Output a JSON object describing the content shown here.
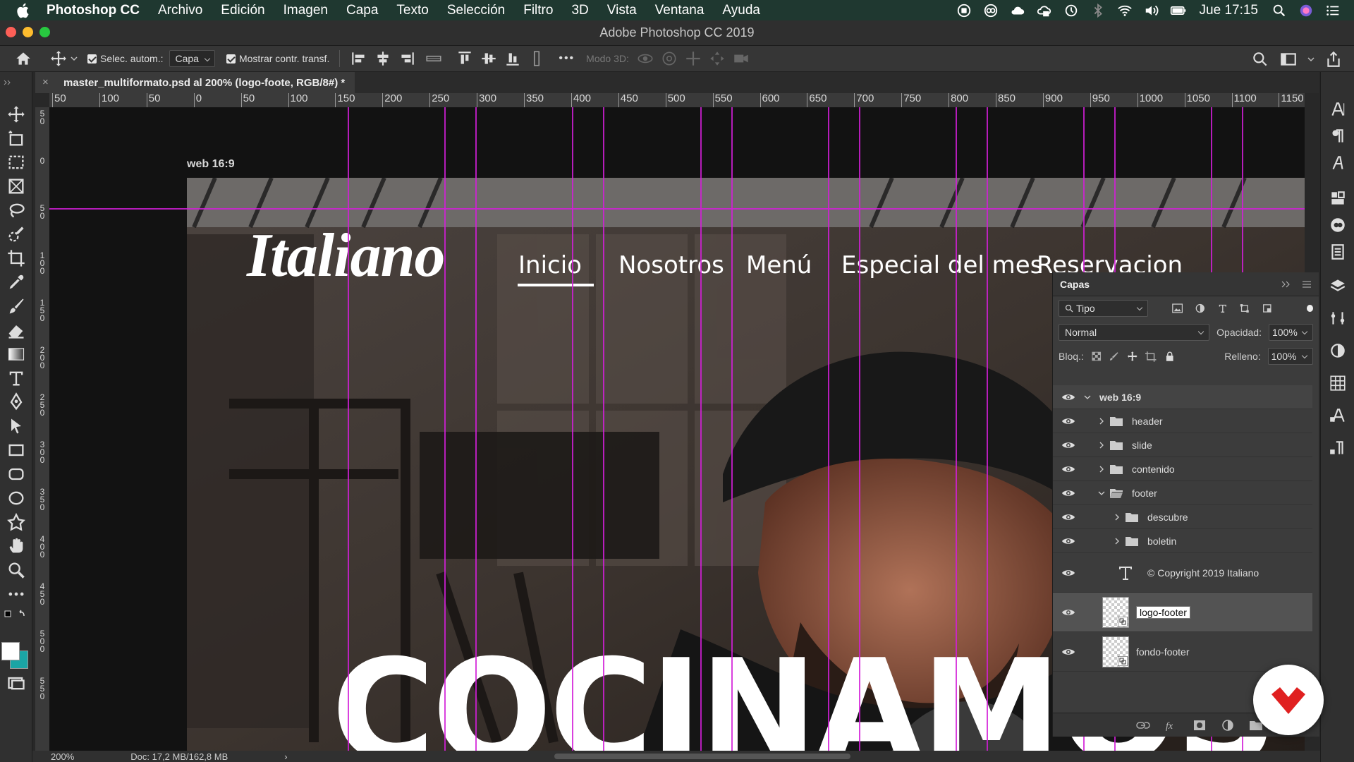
{
  "menubar": {
    "app_name": "Photoshop CC",
    "items": [
      "Archivo",
      "Edición",
      "Imagen",
      "Capa",
      "Texto",
      "Selección",
      "Filtro",
      "3D",
      "Vista",
      "Ventana",
      "Ayuda"
    ],
    "clock": "Jue 17:15"
  },
  "window": {
    "title": "Adobe Photoshop CC 2019",
    "light_colors": [
      "#fe5f57",
      "#febc2e",
      "#28c840"
    ]
  },
  "options": {
    "auto_select_label": "Selec. autom.:",
    "auto_select_value": "Capa",
    "show_transform_label": "Mostrar contr. transf.",
    "more_label": "•••",
    "mode_3d_label": "Modo 3D:"
  },
  "document": {
    "tab_title": "master_multiformato.psd al 200% (logo-foote, RGB/8#) *",
    "close_glyph": "×"
  },
  "rulers": {
    "horizontal": [
      "50",
      "100",
      "50",
      "0",
      "50",
      "100",
      "150",
      "200",
      "250",
      "300",
      "350",
      "400",
      "450",
      "500",
      "550",
      "600",
      "650",
      "700",
      "750",
      "800",
      "850",
      "900",
      "950",
      "1000",
      "1050",
      "1100",
      "1150"
    ],
    "vertical": [
      "5\n0",
      "0",
      "5\n0",
      "1\n0\n0",
      "1\n5\n0",
      "2\n0\n0",
      "2\n5\n0",
      "3\n0\n0",
      "3\n5\n0",
      "4\n0\n0",
      "4\n5\n0",
      "5\n0\n0",
      "5\n5\n0"
    ]
  },
  "artboard": {
    "name": "web 16:9",
    "logo": "Italiano",
    "nav": [
      "Inicio",
      "Nosotros",
      "Menú",
      "Especial del mes",
      "Reservacion"
    ],
    "hero": "COCINAMOS"
  },
  "guide_color": "#d21fd8",
  "status": {
    "zoom": "200%",
    "doc": "Doc: 17,2 MB/162,8 MB",
    "arrow": "›"
  },
  "layers_panel": {
    "title": "Capas",
    "filter_label": "Tipo",
    "blend_mode": "Normal",
    "opacity_label": "Opacidad:",
    "opacity_value": "100%",
    "lock_label": "Bloq.:",
    "fill_label": "Relleno:",
    "fill_value": "100%",
    "layers": [
      {
        "name": "web 16:9",
        "kind": "artboard",
        "expanded": true
      },
      {
        "name": "header",
        "kind": "group",
        "expanded": false
      },
      {
        "name": "slide",
        "kind": "group",
        "expanded": false
      },
      {
        "name": "contenido",
        "kind": "group",
        "expanded": false
      },
      {
        "name": "footer",
        "kind": "group",
        "expanded": true
      },
      {
        "name": "descubre",
        "kind": "group",
        "expanded": false
      },
      {
        "name": "boletin",
        "kind": "group",
        "expanded": false
      },
      {
        "name": "© Copyright 2019 Italiano",
        "kind": "text"
      },
      {
        "name": "logo-footer",
        "kind": "smart-object",
        "selected": true
      },
      {
        "name": "fondo-footer",
        "kind": "smart-object"
      }
    ],
    "footer_icons": [
      "link-icon",
      "fx-icon",
      "mask-icon",
      "adjustment-icon",
      "new-group-icon"
    ]
  },
  "badge_color": "#e02020"
}
